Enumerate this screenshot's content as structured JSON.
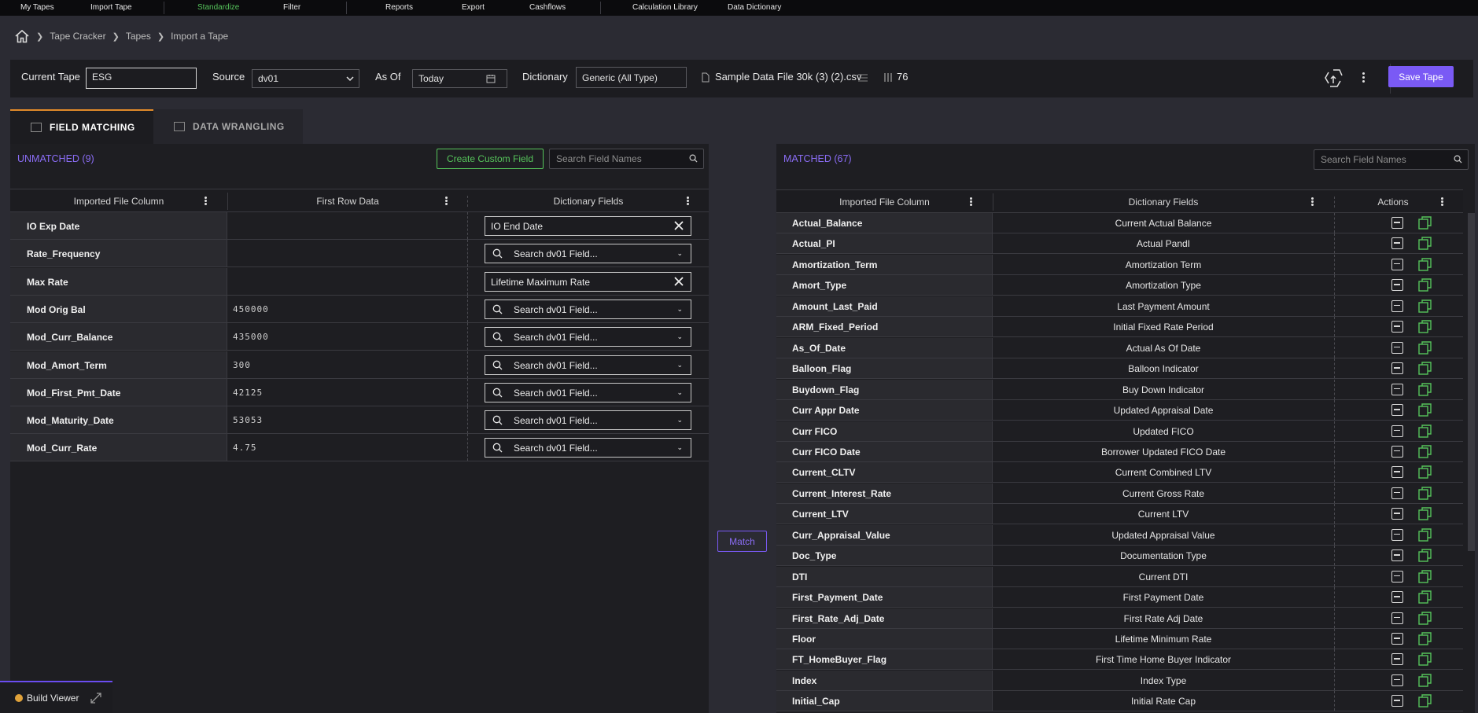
{
  "nav": {
    "items": [
      {
        "label": "My Tapes",
        "active": false
      },
      {
        "label": "Import Tape",
        "active": false
      },
      {
        "label": "Standardize",
        "active": true
      },
      {
        "label": "Filter",
        "active": false
      },
      {
        "label": "Reports",
        "active": false
      },
      {
        "label": "Export",
        "active": false
      },
      {
        "label": "Cashflows",
        "active": false
      },
      {
        "label": "Calculation Library",
        "active": false
      },
      {
        "label": "Data Dictionary",
        "active": false
      }
    ]
  },
  "breadcrumb": {
    "home_icon": "home-icon",
    "items": [
      "Tape Cracker",
      "Tapes",
      "Import a Tape"
    ]
  },
  "toolbar": {
    "current_tape_label": "Current Tape",
    "current_tape_value": "ESG",
    "source_label": "Source",
    "source_value": "dv01",
    "as_of_label": "As Of",
    "as_of_value": "Today",
    "dictionary_label": "Dictionary",
    "dictionary_value": "Generic (All Type)",
    "file_name": "Sample Data File 30k (3) (2).csv",
    "column_count": "76",
    "save_label": "Save Tape"
  },
  "tabs": [
    {
      "label": "FIELD MATCHING",
      "active": true
    },
    {
      "label": "DATA WRANGLING",
      "active": false
    }
  ],
  "unmatched": {
    "title": "UNMATCHED (9)",
    "create_custom_label": "Create Custom Field",
    "search_placeholder": "Search Field Names",
    "columns": [
      "Imported File Column",
      "First Row Data",
      "Dictionary Fields"
    ],
    "rows": [
      {
        "column": "IO Exp Date",
        "first_row": "",
        "dictionary": "IO End Date",
        "selected": true
      },
      {
        "column": "Rate_Frequency",
        "first_row": "",
        "dictionary": "Search dv01 Field...",
        "selected": false
      },
      {
        "column": "Max Rate",
        "first_row": "",
        "dictionary": "Lifetime Maximum Rate",
        "selected": true
      },
      {
        "column": "Mod Orig Bal",
        "first_row": "450000",
        "dictionary": "Search dv01 Field...",
        "selected": false
      },
      {
        "column": "Mod_Curr_Balance",
        "first_row": "435000",
        "dictionary": "Search dv01 Field...",
        "selected": false
      },
      {
        "column": "Mod_Amort_Term",
        "first_row": "300",
        "dictionary": "Search dv01 Field...",
        "selected": false
      },
      {
        "column": "Mod_First_Pmt_Date",
        "first_row": "42125",
        "dictionary": "Search dv01 Field...",
        "selected": false
      },
      {
        "column": "Mod_Maturity_Date",
        "first_row": "53053",
        "dictionary": "Search dv01 Field...",
        "selected": false
      },
      {
        "column": "Mod_Curr_Rate",
        "first_row": "4.75",
        "dictionary": "Search dv01 Field...",
        "selected": false
      }
    ]
  },
  "match_label": "Match",
  "matched": {
    "title": "MATCHED (67)",
    "search_placeholder": "Search Field Names",
    "columns": [
      "Imported File Column",
      "Dictionary Fields",
      "Actions"
    ],
    "rows": [
      {
        "column": "Actual_Balance",
        "dictionary": "Current Actual Balance"
      },
      {
        "column": "Actual_PI",
        "dictionary": "Actual PandI"
      },
      {
        "column": "Amortization_Term",
        "dictionary": "Amortization Term"
      },
      {
        "column": "Amort_Type",
        "dictionary": "Amortization Type"
      },
      {
        "column": "Amount_Last_Paid",
        "dictionary": "Last Payment Amount"
      },
      {
        "column": "ARM_Fixed_Period",
        "dictionary": "Initial Fixed Rate Period"
      },
      {
        "column": "As_Of_Date",
        "dictionary": "Actual As Of Date"
      },
      {
        "column": "Balloon_Flag",
        "dictionary": "Balloon Indicator"
      },
      {
        "column": "Buydown_Flag",
        "dictionary": "Buy Down Indicator"
      },
      {
        "column": "Curr Appr Date",
        "dictionary": "Updated Appraisal Date"
      },
      {
        "column": "Curr FICO",
        "dictionary": "Updated FICO"
      },
      {
        "column": "Curr FICO Date",
        "dictionary": "Borrower Updated FICO Date"
      },
      {
        "column": "Current_CLTV",
        "dictionary": "Current Combined LTV"
      },
      {
        "column": "Current_Interest_Rate",
        "dictionary": "Current Gross Rate"
      },
      {
        "column": "Current_LTV",
        "dictionary": "Current LTV"
      },
      {
        "column": "Curr_Appraisal_Value",
        "dictionary": "Updated Appraisal Value"
      },
      {
        "column": "Doc_Type",
        "dictionary": "Documentation Type"
      },
      {
        "column": "DTI",
        "dictionary": "Current DTI"
      },
      {
        "column": "First_Payment_Date",
        "dictionary": "First Payment Date"
      },
      {
        "column": "First_Rate_Adj_Date",
        "dictionary": "First Rate Adj Date"
      },
      {
        "column": "Floor",
        "dictionary": "Lifetime Minimum Rate"
      },
      {
        "column": "FT_HomeBuyer_Flag",
        "dictionary": "First Time Home Buyer Indicator"
      },
      {
        "column": "Index",
        "dictionary": "Index Type"
      },
      {
        "column": "Initial_Cap",
        "dictionary": "Initial Rate Cap"
      }
    ]
  },
  "build_viewer_label": "Build Viewer"
}
